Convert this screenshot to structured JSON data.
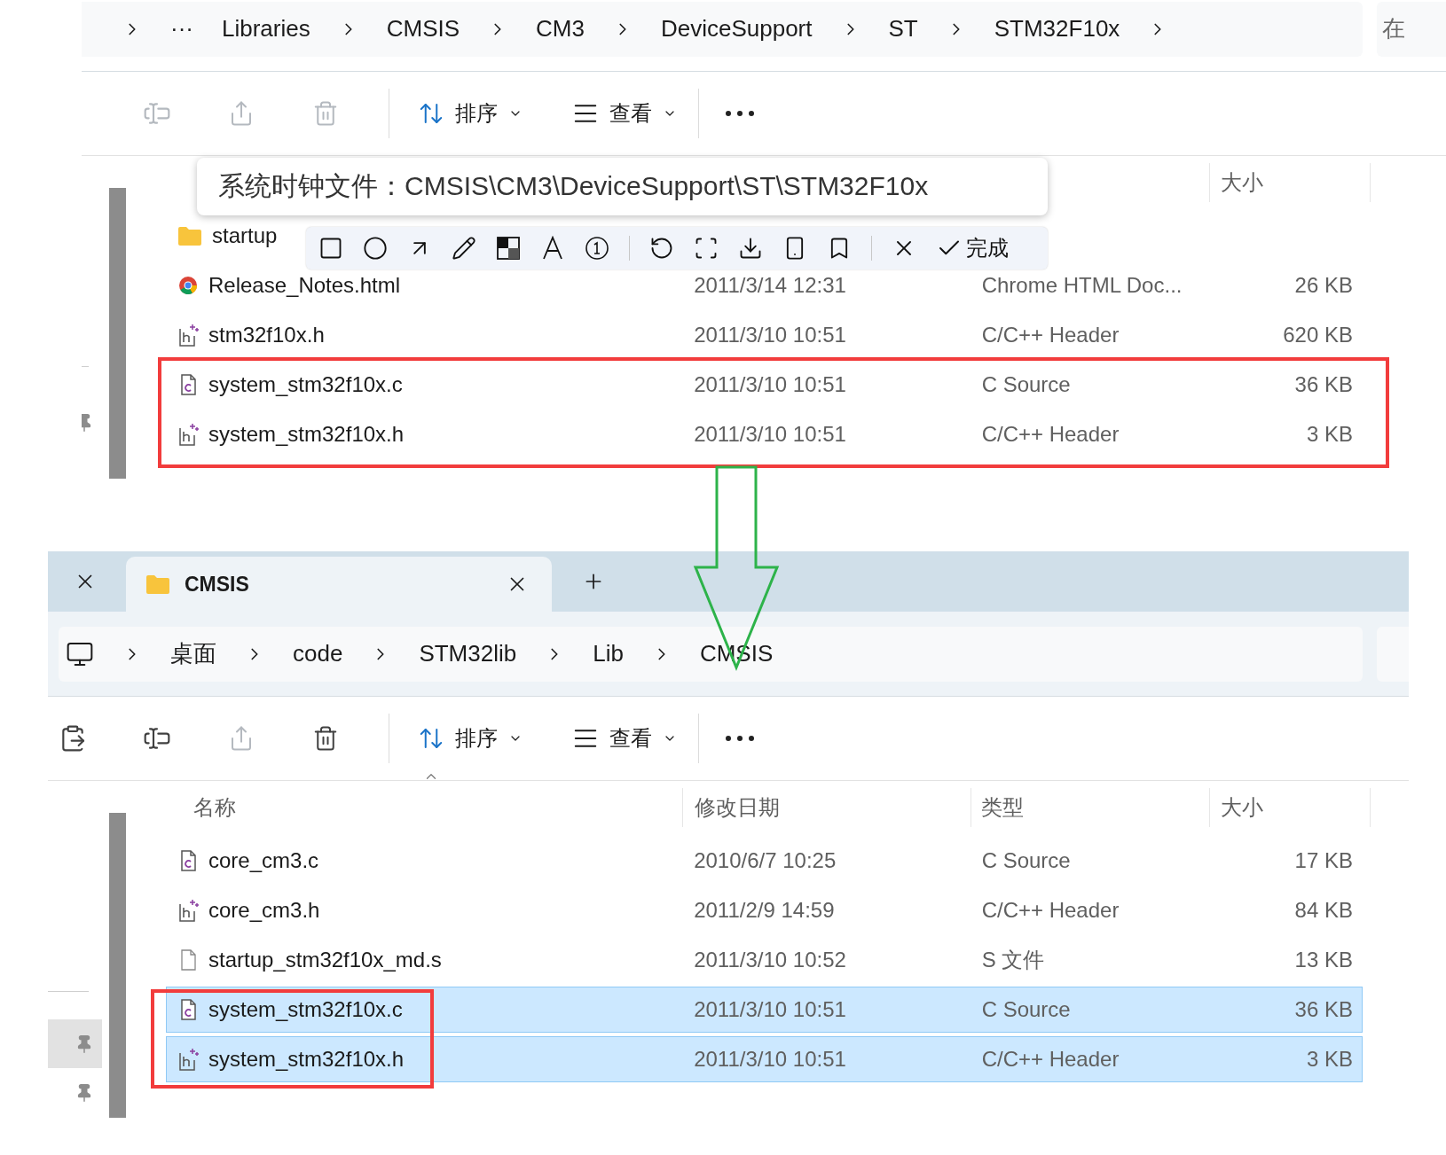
{
  "top_window": {
    "overflow": "···",
    "breadcrumb": [
      "Libraries",
      "CMSIS",
      "CM3",
      "DeviceSupport",
      "ST",
      "STM32F10x"
    ],
    "trailing_chevron": true,
    "search_placeholder": "在",
    "toolbar": {
      "actions": [
        {
          "kind": "rename",
          "disabled": true
        },
        {
          "kind": "share",
          "disabled": true
        },
        {
          "kind": "delete",
          "disabled": true
        }
      ],
      "sort": "排序",
      "view": "查看"
    },
    "columns": [
      {
        "kind": "size",
        "label": "大小"
      }
    ],
    "nav_pins": [
      {
        "hovered": false
      }
    ],
    "files": [
      {
        "kind": "folder",
        "name": "startup",
        "selected": false
      },
      {
        "kind": "html",
        "name": "Release_Notes.html",
        "date": "2011/3/14 12:31",
        "type": "Chrome HTML Doc...",
        "size": "26 KB",
        "selected": false
      },
      {
        "kind": "header",
        "name": "stm32f10x.h",
        "date": "2011/3/10 10:51",
        "type": "C/C++ Header",
        "size": "620 KB",
        "selected": false
      },
      {
        "kind": "c",
        "name": "system_stm32f10x.c",
        "date": "2011/3/10 10:51",
        "type": "C Source",
        "size": "36 KB",
        "selected": false
      },
      {
        "kind": "header",
        "name": "system_stm32f10x.h",
        "date": "2011/3/10 10:51",
        "type": "C/C++ Header",
        "size": "3 KB",
        "selected": false
      }
    ]
  },
  "tooltip": {
    "text": "系统时钟文件：CMSIS\\CM3\\DeviceSupport\\ST\\STM32F10x"
  },
  "capture_toolbar": {
    "done": "完成"
  },
  "bottom_window": {
    "tabs": [
      {
        "label": "CMSIS",
        "selected": true
      }
    ],
    "home_icon": true,
    "breadcrumb": [
      "桌面",
      "code",
      "STM32lib",
      "Lib",
      "CMSIS"
    ],
    "toolbar": {
      "actions": [
        {
          "kind": "paste",
          "disabled": false
        },
        {
          "kind": "rename",
          "disabled": false
        },
        {
          "kind": "share",
          "disabled": true
        },
        {
          "kind": "delete",
          "disabled": false
        }
      ],
      "sort": "排序",
      "view": "查看"
    },
    "columns": [
      {
        "kind": "name",
        "label": "名称"
      },
      {
        "kind": "date",
        "label": "修改日期"
      },
      {
        "kind": "type",
        "label": "类型"
      },
      {
        "kind": "size",
        "label": "大小"
      }
    ],
    "sort_indicator": true,
    "nav_pins": [
      {
        "hovered": true
      },
      {
        "hovered": false
      }
    ],
    "files": [
      {
        "kind": "c",
        "name": "core_cm3.c",
        "date": "2010/6/7 10:25",
        "type": "C Source",
        "size": "17 KB",
        "selected": false
      },
      {
        "kind": "header",
        "name": "core_cm3.h",
        "date": "2011/2/9 14:59",
        "type": "C/C++ Header",
        "size": "84 KB",
        "selected": false
      },
      {
        "kind": "plain",
        "name": "startup_stm32f10x_md.s",
        "date": "2011/3/10 10:52",
        "type": "S 文件",
        "size": "13 KB",
        "selected": false
      },
      {
        "kind": "c",
        "name": "system_stm32f10x.c",
        "date": "2011/3/10 10:51",
        "type": "C Source",
        "size": "36 KB",
        "selected": true
      },
      {
        "kind": "header",
        "name": "system_stm32f10x.h",
        "date": "2011/3/10 10:51",
        "type": "C/C++ Header",
        "size": "3 KB",
        "selected": true
      }
    ]
  }
}
